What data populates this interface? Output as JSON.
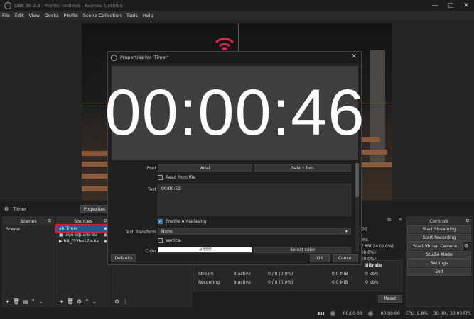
{
  "window": {
    "title": "OBS 30.2.3 - Profile: Untitled - Scenes: Untitled",
    "controls": [
      "—",
      "□",
      "✕"
    ]
  },
  "menu": [
    "File",
    "Edit",
    "View",
    "Docks",
    "Profile",
    "Scene Collection",
    "Tools",
    "Help"
  ],
  "properties_dialog": {
    "title": "Properties for 'Timer'",
    "timer_display": "00:00:46",
    "font_label": "Font",
    "font_value": "Arial",
    "select_font": "Select font",
    "read_from_file": "Read from file",
    "text_label": "Text",
    "text_value": "00:00:52",
    "enable_antialiasing": "Enable Antialiasing",
    "text_transform_label": "Text Transform",
    "text_transform_value": "None",
    "vertical": "Vertical",
    "color_label": "Color",
    "color_value": "#ffffff",
    "select_color": "Select color",
    "defaults": "Defaults",
    "ok": "OK",
    "cancel": "Cancel"
  },
  "source_bar": {
    "source_name": "Timer",
    "properties_btn": "Properties"
  },
  "scenes": {
    "header": "Scenes",
    "items": [
      "Scene"
    ]
  },
  "sources": {
    "header": "Sources",
    "items": [
      "Timer",
      "logo-square-bla",
      "BB_f53be17e-6a"
    ]
  },
  "audio_mixer_fragment": {
    "value_a": "00",
    "value_b": "ms",
    "value_c": "/ 85024 (0.0%)",
    "value_d": "(0.0%)",
    "value_e": "(0.0%)"
  },
  "stats": {
    "bitrate_header": "Bitrate",
    "rows": [
      {
        "name": "Stream",
        "status": "Inactive",
        "frames": "0 / 0 (0.0%)",
        "data": "0.0 MiB",
        "bitrate": "0 kb/s"
      },
      {
        "name": "Recording",
        "status": "Inactive",
        "frames": "0 / 0 (0.0%)",
        "data": "0.0 MiB",
        "bitrate": "0 kb/s"
      }
    ],
    "reset": "Reset"
  },
  "controls": {
    "header": "Controls",
    "buttons": [
      "Start Streaming",
      "Start Recording",
      "Start Virtual Camera",
      "Studio Mode",
      "Settings",
      "Exit"
    ]
  },
  "status": {
    "stream_time": "00:00:00",
    "rec_time": "00:00:00",
    "cpu": "CPU: 6.8%",
    "fps": "30.00 / 30.00 FPS"
  }
}
